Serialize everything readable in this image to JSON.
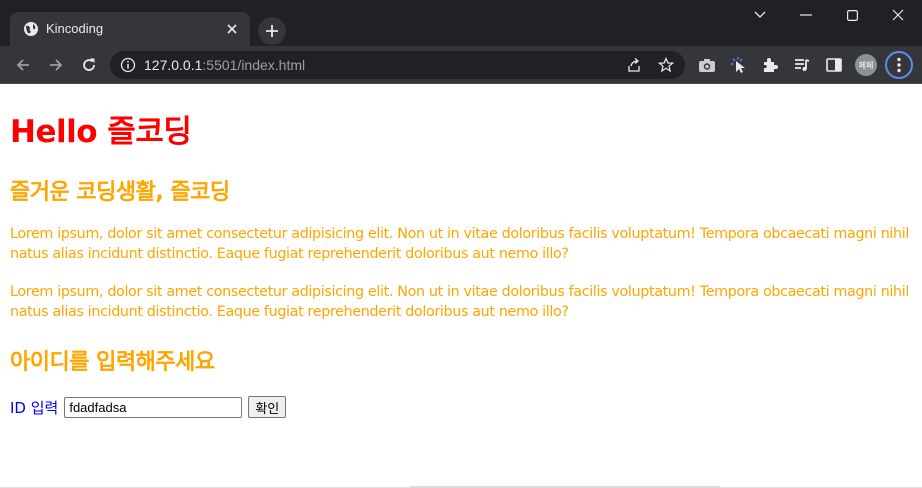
{
  "browser": {
    "tab": {
      "title": "Kincoding",
      "favicon": "globe-icon"
    },
    "address": {
      "host": "127.0.0.1",
      "rest": ":5501/index.html"
    },
    "profile_avatar_text": "페페",
    "icons": [
      "back-icon",
      "forward-icon",
      "reload-icon",
      "site-info-icon",
      "share-icon",
      "bookmark-star-icon",
      "camera-icon",
      "cursor-icon",
      "extensions-icon",
      "media-queue-icon",
      "side-panel-icon",
      "menu-icon"
    ]
  },
  "page": {
    "heading": "Hello 즐코딩",
    "subheading": "즐거운 코딩생활, 즐코딩",
    "paragraphs": [
      "Lorem ipsum, dolor sit amet consectetur adipisicing elit. Non ut in vitae doloribus facilis voluptatum! Tempora obcaecati magni nihil natus alias incidunt distinctio. Eaque fugiat reprehenderit doloribus aut nemo illo?",
      "Lorem ipsum, dolor sit amet consectetur adipisicing elit. Non ut in vitae doloribus facilis voluptatum! Tempora obcaecati magni nihil natus alias incidunt distinctio. Eaque fugiat reprehenderit doloribus aut nemo illo?"
    ],
    "form_heading": "아이디를 입력해주세요",
    "form": {
      "label": "ID 입력",
      "input_value": "fdadfadsa",
      "button_label": "확인"
    }
  },
  "colors": {
    "heading": "#ff0000",
    "subheading": "#ffa500",
    "paragraph": "#ffa500",
    "label": "#0000ff"
  }
}
